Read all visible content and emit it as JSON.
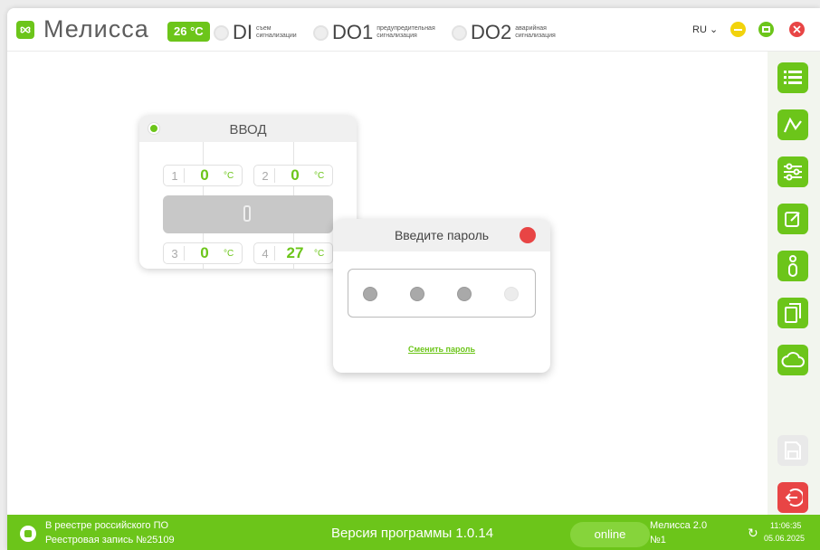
{
  "header": {
    "app_title": "Мелисса",
    "temperature": "26 °C",
    "indicators": [
      {
        "name": "DI",
        "desc": "съем сигнализации"
      },
      {
        "name": "DO1",
        "desc": "предупредительная сигнализация"
      },
      {
        "name": "DO2",
        "desc": "аварийная сигнализация"
      }
    ],
    "language": "RU",
    "icons": {
      "logo": "flower-logo-icon",
      "minimize": "minimize-icon",
      "maximize": "maximize-icon",
      "close": "close-icon"
    }
  },
  "toolbar": {
    "icons": [
      "list-icon",
      "chart-line-icon",
      "sliders-icon",
      "edit-icon",
      "info-icon",
      "documents-icon",
      "cloud-icon",
      "save-icon",
      "exit-icon"
    ]
  },
  "input_card": {
    "title": "ВВОД",
    "channels": [
      {
        "num": "1",
        "value": "0",
        "unit": "°C"
      },
      {
        "num": "2",
        "value": "0",
        "unit": "°C"
      },
      {
        "num": "3",
        "value": "0",
        "unit": "°C"
      },
      {
        "num": "4",
        "value": "27",
        "unit": "°C"
      }
    ]
  },
  "password_dialog": {
    "title": "Введите пароль",
    "entered_digits": 3,
    "total_digits": 4,
    "change_password": "Сменить пароль"
  },
  "footer": {
    "registry_line1": "В реестре российского ПО",
    "registry_line2": "Реестровая запись №25109",
    "version": "Версия программы  1.0.14",
    "status": "online",
    "device_line1": "Мелисса 2.0",
    "device_line2": "№1",
    "time": "11:06:35",
    "date": "05.06.2025"
  },
  "colors": {
    "accent": "#6cc51a",
    "danger": "#e84545",
    "disabled": "#c8c8c8"
  }
}
